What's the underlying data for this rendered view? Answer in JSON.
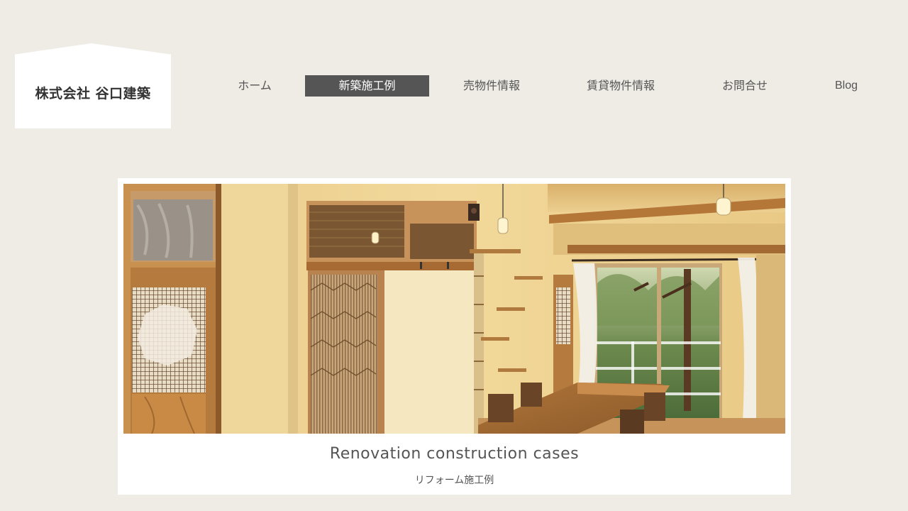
{
  "brand": {
    "name": "株式会社 谷口建築"
  },
  "nav": {
    "items": [
      {
        "label": "ホーム",
        "active": false
      },
      {
        "label": "新築施工例",
        "active": true
      },
      {
        "label": "売物件情報",
        "active": false
      },
      {
        "label": "賃貸物件情報",
        "active": false
      },
      {
        "label": "お問合せ",
        "active": false
      },
      {
        "label": "Blog",
        "active": false
      }
    ]
  },
  "feature": {
    "title": "Renovation construction cases",
    "subtitle": "リフォーム施工例",
    "image": "renovated-japanese-dining-room-photo"
  },
  "colors": {
    "background": "#efebe5",
    "nav_active_bg": "#555555",
    "text": "#555555",
    "card": "#ffffff"
  }
}
